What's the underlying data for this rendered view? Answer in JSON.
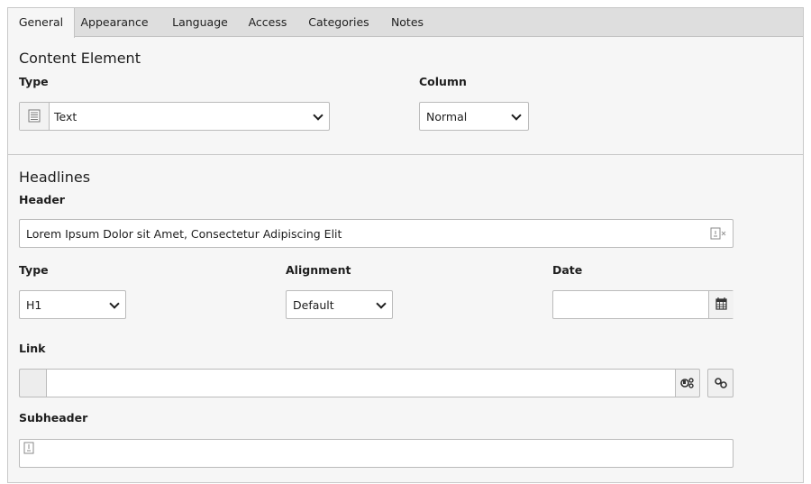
{
  "tabs": [
    "General",
    "Appearance",
    "Language",
    "Access",
    "Categories",
    "Notes"
  ],
  "content_element": {
    "title": "Content Element",
    "type_label": "Type",
    "type_value": "Text",
    "column_label": "Column",
    "column_value": "Normal"
  },
  "headlines": {
    "title": "Headlines",
    "header_label": "Header",
    "header_value": "Lorem Ipsum Dolor sit Amet, Consectetur Adipiscing Elit",
    "type_label": "Type",
    "type_value": "H1",
    "alignment_label": "Alignment",
    "alignment_value": "Default",
    "date_label": "Date",
    "date_value": "",
    "link_label": "Link",
    "link_value": "",
    "subheader_label": "Subheader",
    "subheader_value": ""
  }
}
